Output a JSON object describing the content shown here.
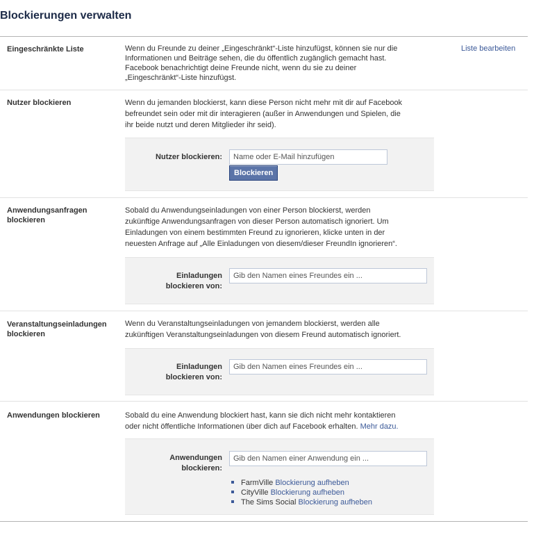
{
  "page": {
    "title": "Blockierungen verwalten"
  },
  "restricted": {
    "label": "Eingeschränkte Liste",
    "lines": [
      "Wenn du Freunde zu deiner „Eingeschränkt“-Liste hinzufügst, können sie nur die",
      "Informationen und Beiträge sehen, die du öffentlich zugänglich gemacht hast.",
      "Facebook benachrichtigt deine Freunde nicht, wenn du sie zu deiner",
      "„Eingeschränkt“-Liste hinzufügst."
    ],
    "edit_link": "Liste bearbeiten"
  },
  "block_users": {
    "label": "Nutzer blockieren",
    "lines": [
      "Wenn du jemanden blockierst, kann diese Person nicht mehr mit dir auf Facebook",
      "befreundet sein oder mit dir interagieren (außer in Anwendungen und Spielen, die",
      "ihr beide nutzt und deren Mitglieder ihr seid)."
    ],
    "field_label": "Nutzer blockieren:",
    "placeholder": "Name oder E-Mail hinzufügen",
    "button": "Blockieren"
  },
  "app_requests": {
    "label_lines": [
      "Anwendungsanfragen",
      "blockieren"
    ],
    "lines": [
      "Sobald du Anwendungseinladungen von einer Person blockierst, werden",
      "zukünftige Anwendungsanfragen von dieser Person automatisch ignoriert. Um",
      "Einladungen von einem bestimmten Freund zu ignorieren, klicke unten in der",
      "neuesten Anfrage auf „Alle Einladungen von diesem/dieser FreundIn ignorieren“."
    ],
    "field_label_lines": [
      "Einladungen",
      "blockieren von:"
    ],
    "placeholder": "Gib den Namen eines Freundes ein ..."
  },
  "event_invites": {
    "label_lines": [
      "Veranstaltungseinladungen",
      "blockieren"
    ],
    "lines": [
      "Wenn du Veranstaltungseinladungen von jemandem blockierst, werden alle",
      "zukünftigen Veranstaltungseinladungen von diesem Freund automatisch ignoriert."
    ],
    "field_label_lines": [
      "Einladungen",
      "blockieren von:"
    ],
    "placeholder": "Gib den Namen eines Freundes ein ..."
  },
  "block_apps": {
    "label": "Anwendungen blockieren",
    "line1": "Sobald du eine Anwendung blockiert hast, kann sie dich nicht mehr kontaktieren",
    "line2": "oder nicht öffentliche Informationen über dich auf Facebook erhalten.",
    "more_link": "Mehr dazu.",
    "field_label_lines": [
      "Anwendungen",
      "blockieren:"
    ],
    "placeholder": "Gib den Namen einer Anwendung ein ...",
    "blocked_apps": [
      {
        "name": "FarmVille",
        "unblock": "Blockierung aufheben"
      },
      {
        "name": "CityVille",
        "unblock": "Blockierung aufheben"
      },
      {
        "name": "The Sims Social",
        "unblock": "Blockierung aufheben"
      }
    ]
  },
  "colors": {
    "link": "#3b5998",
    "title": "#1c2a47",
    "button": "#5b74a8",
    "panel": "#f2f2f2"
  }
}
